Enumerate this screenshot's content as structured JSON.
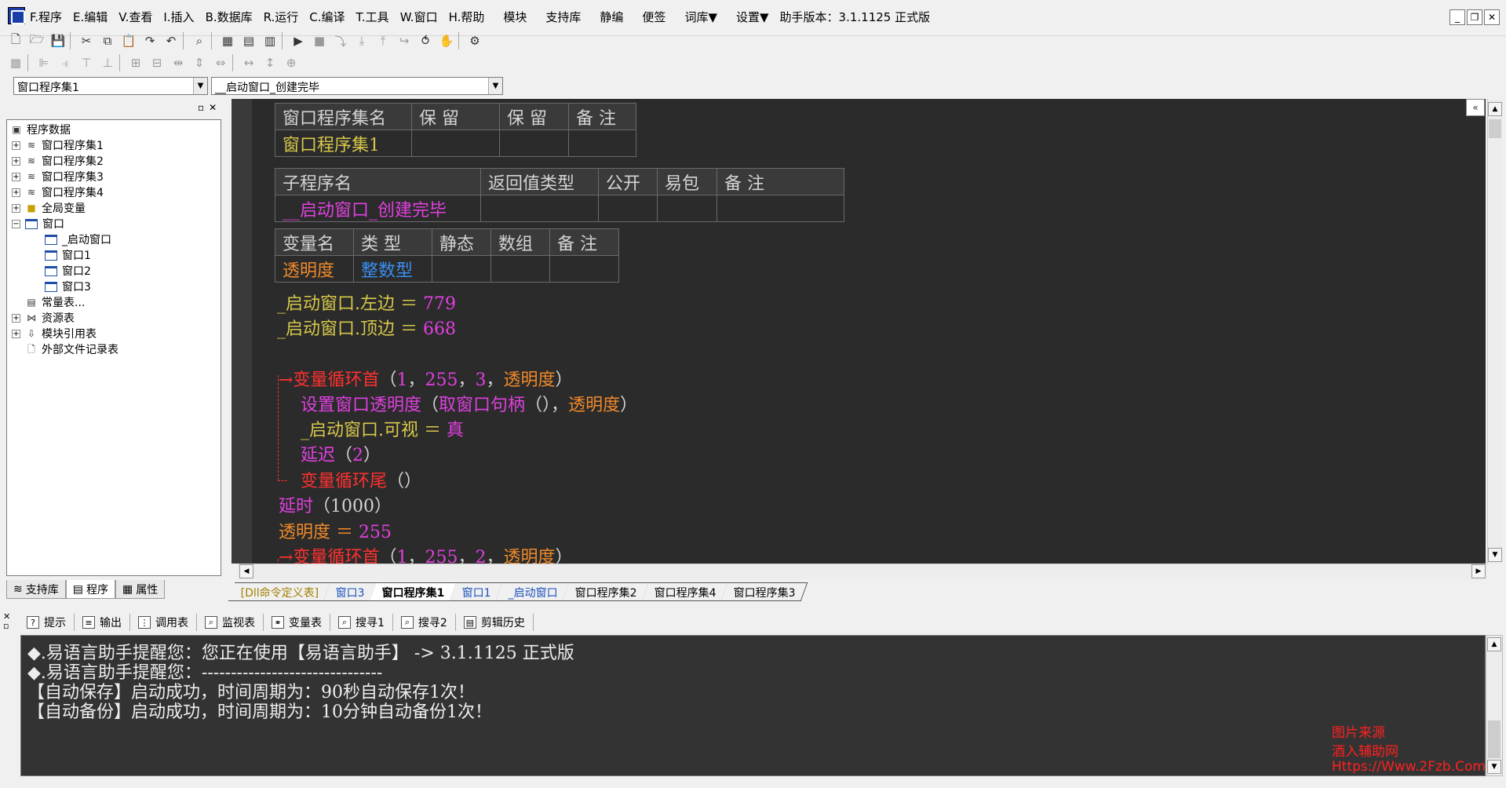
{
  "menubar": {
    "items": [
      "F.程序",
      "E.编辑",
      "V.查看",
      "I.插入",
      "B.数据库",
      "R.运行",
      "C.编译",
      "T.工具",
      "W.窗口",
      "H.帮助"
    ],
    "extras": [
      "模块",
      "支持库",
      "静编",
      "便签",
      "词库▼",
      "设置▼"
    ],
    "version": "助手版本：3.1.1125 正式版",
    "win_controls": [
      "_",
      "❐",
      "✕"
    ]
  },
  "combos": {
    "assembly": "窗口程序集1",
    "subroutine": "__启动窗口_创建完毕"
  },
  "tree": {
    "root": "程序数据",
    "items": [
      {
        "label": "窗口程序集1",
        "level": 1,
        "pm": "+"
      },
      {
        "label": "窗口程序集2",
        "level": 1,
        "pm": "+"
      },
      {
        "label": "窗口程序集3",
        "level": 1,
        "pm": "+"
      },
      {
        "label": "窗口程序集4",
        "level": 1,
        "pm": "+"
      },
      {
        "label": "全局变量",
        "level": 1,
        "pm": "+"
      },
      {
        "label": "窗口",
        "level": 1,
        "pm": "-"
      },
      {
        "label": "_启动窗口",
        "level": 2,
        "pm": ""
      },
      {
        "label": "窗口1",
        "level": 2,
        "pm": ""
      },
      {
        "label": "窗口2",
        "level": 2,
        "pm": ""
      },
      {
        "label": "窗口3",
        "level": 2,
        "pm": ""
      },
      {
        "label": "常量表...",
        "level": 1,
        "pm": ""
      },
      {
        "label": "资源表",
        "level": 1,
        "pm": "+"
      },
      {
        "label": "模块引用表",
        "level": 1,
        "pm": "+"
      },
      {
        "label": "外部文件记录表",
        "level": 1,
        "pm": ""
      }
    ]
  },
  "left_tabs": [
    "支持库",
    "程序",
    "属性"
  ],
  "editor": {
    "table1": {
      "headers": [
        "窗口程序集名",
        "保 留",
        "保 留",
        "备 注"
      ],
      "row": [
        "窗口程序集1",
        "",
        "",
        ""
      ]
    },
    "table2": {
      "headers": [
        "子程序名",
        "返回值类型",
        "公开",
        "易包",
        "备 注"
      ],
      "row": [
        "__启动窗口_创建完毕",
        "",
        "",
        "",
        ""
      ]
    },
    "table3": {
      "headers": [
        "变量名",
        "类 型",
        "静态",
        "数组",
        "备 注"
      ],
      "row": [
        "透明度",
        "整数型",
        "",
        "",
        ""
      ]
    },
    "lines": {
      "l1a": "_启动窗口.左边 ＝ ",
      "l1b": "779",
      "l2a": "_启动窗口.顶边 ＝ ",
      "l2b": "668",
      "l3a": "变量循环首",
      "l3b": "（",
      "l3c": "1",
      "l3d": "，",
      "l3e": "255",
      "l3f": "，",
      "l3g": "3",
      "l3h": "，",
      "l3i": "透明度",
      "l3j": "）",
      "l4a": "设置窗口透明度",
      "l4b": "（",
      "l4c": "取窗口句柄",
      "l4d": "（），",
      "l4e": "透明度",
      "l4f": "）",
      "l5a": "_启动窗口.可视 ＝ ",
      "l5b": "真",
      "l6a": "延迟",
      "l6b": "（",
      "l6c": "2",
      "l6d": "）",
      "l7a": "变量循环尾",
      "l7b": "（）",
      "l8a": "延时",
      "l8b": "（1000）",
      "l9a": "透明度 ＝ ",
      "l9b": "255",
      "l10a": "变量循环首",
      "l10b": "（",
      "l10c": "1",
      "l10d": "，",
      "l10e": "255",
      "l10f": "，",
      "l10g": "2",
      "l10h": "，",
      "l10i": "透明度",
      "l10j": "）"
    }
  },
  "editor_tabs": [
    "[Dll命令定义表]",
    "窗口3",
    "窗口程序集1",
    "窗口1",
    "_启动窗口",
    "窗口程序集2",
    "窗口程序集4",
    "窗口程序集3"
  ],
  "output_tabs": [
    "提示",
    "输出",
    "调用表",
    "监视表",
    "变量表",
    "搜寻1",
    "搜寻2",
    "剪辑历史"
  ],
  "output_lines": [
    "◆.易语言助手提醒您：您正在使用【易语言助手】 -> 3.1.1125 正式版",
    "◆.易语言助手提醒您：-------------------------------",
    "【自动保存】启动成功，时间周期为：90秒自动保存1次！",
    "【自动备份】启动成功，时间周期为：10分钟自动备份1次！"
  ],
  "watermark": [
    "图片来源",
    "酒入辅助网",
    "Https://Www.2Fzb.Com"
  ]
}
